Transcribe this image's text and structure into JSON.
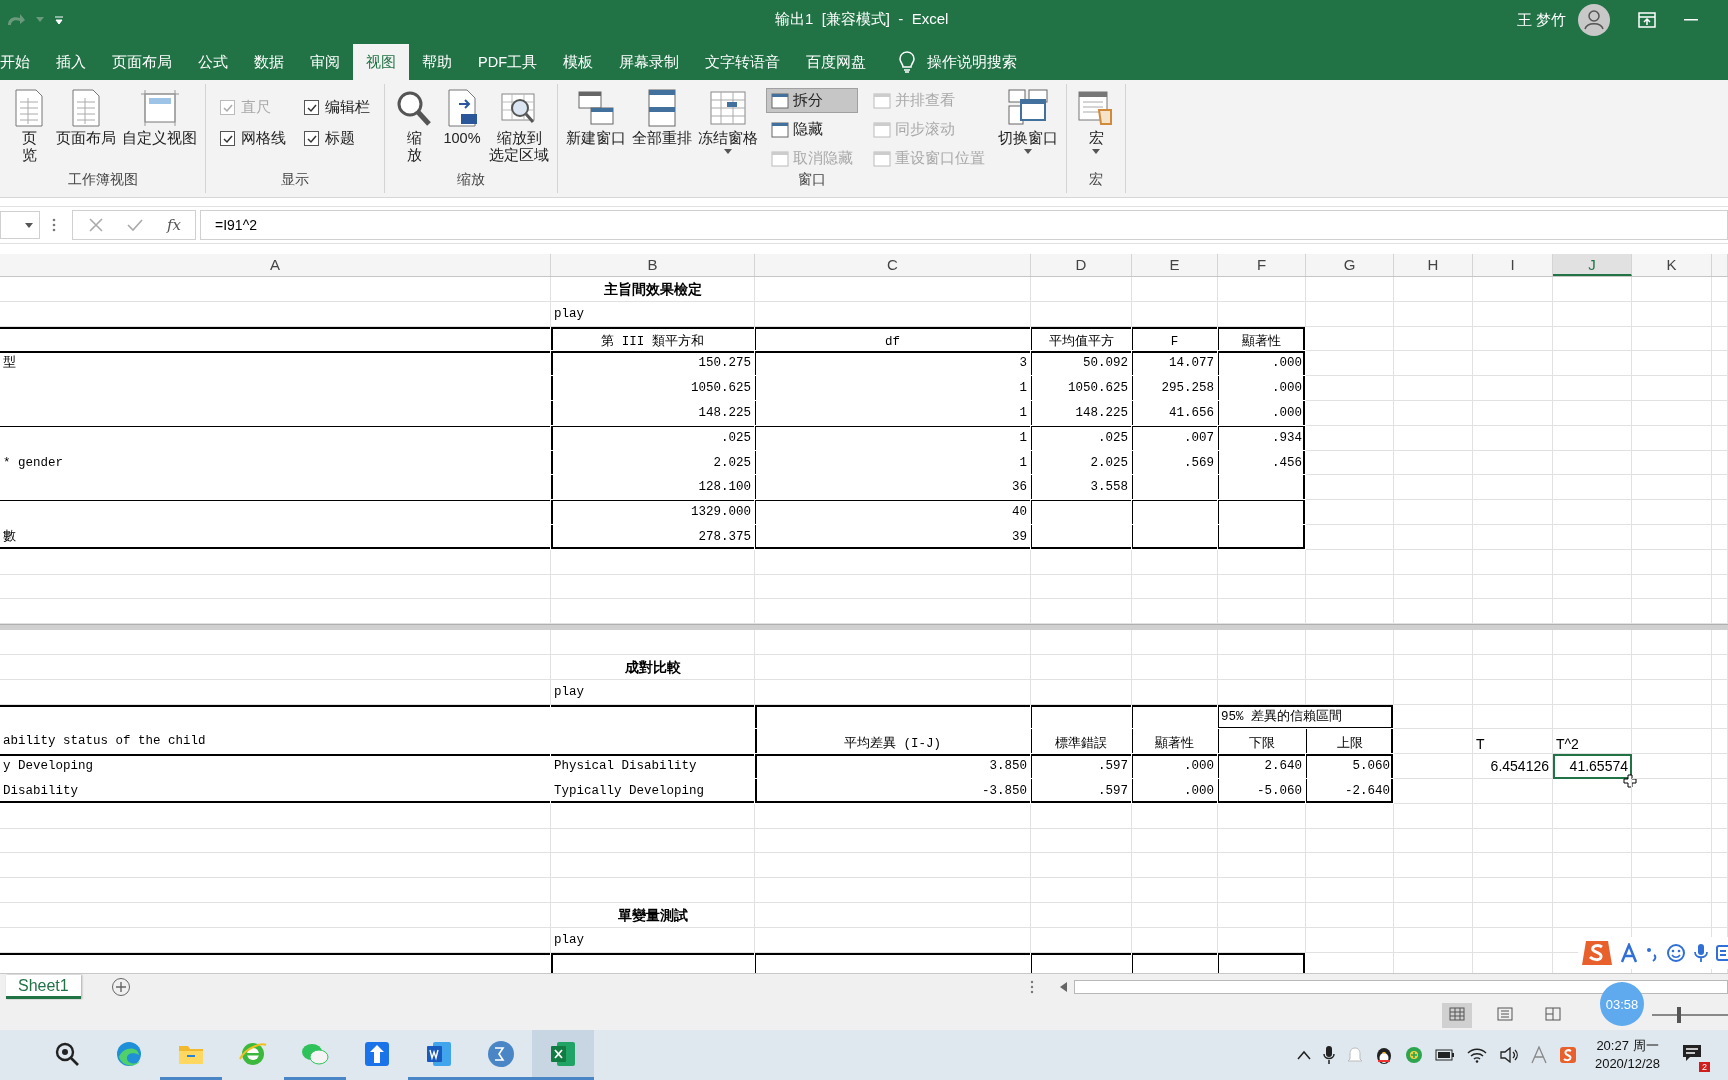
{
  "title_bar": {
    "title": "输出1  [兼容模式]  -  Excel",
    "user": "王 梦竹"
  },
  "ribbon_tabs": [
    {
      "label": "开始",
      "selected": false
    },
    {
      "label": "插入",
      "selected": false
    },
    {
      "label": "页面布局",
      "selected": false
    },
    {
      "label": "公式",
      "selected": false
    },
    {
      "label": "数据",
      "selected": false
    },
    {
      "label": "审阅",
      "selected": false
    },
    {
      "label": "视图",
      "selected": true
    },
    {
      "label": "帮助",
      "selected": false
    },
    {
      "label": "PDF工具",
      "selected": false
    },
    {
      "label": "模板",
      "selected": false
    },
    {
      "label": "屏幕录制",
      "selected": false
    },
    {
      "label": "文字转语音",
      "selected": false
    },
    {
      "label": "百度网盘",
      "selected": false
    }
  ],
  "tell_me": "操作说明搜索",
  "ribbon_groups": [
    {
      "label": "工作簿视图",
      "columns": [
        [
          {
            "kind": "large",
            "lines": [
              "页",
              "览"
            ]
          }
        ],
        [
          {
            "kind": "large",
            "lines": [
              "页面布局"
            ]
          }
        ],
        [
          {
            "kind": "large",
            "lines": [
              "自定义视图"
            ]
          }
        ]
      ]
    },
    {
      "label": "显示",
      "columns": [
        [
          {
            "kind": "checkbox",
            "label": "直尺",
            "checked": true,
            "disabled": true
          },
          {
            "kind": "checkbox",
            "label": "网格线",
            "checked": true,
            "disabled": false
          }
        ],
        [
          {
            "kind": "checkbox",
            "label": "编辑栏",
            "checked": true,
            "disabled": false
          },
          {
            "kind": "checkbox",
            "label": "标题",
            "checked": true,
            "disabled": false
          }
        ]
      ]
    },
    {
      "label": "缩放",
      "columns": [
        [
          {
            "kind": "large",
            "lines": [
              "缩",
              "放"
            ]
          }
        ],
        [
          {
            "kind": "large",
            "lines": [
              "100%"
            ]
          }
        ],
        [
          {
            "kind": "large",
            "lines": [
              "缩放到",
              "选定区域"
            ]
          }
        ]
      ]
    },
    {
      "label": "窗口",
      "columns": [
        [
          {
            "kind": "large",
            "lines": [
              "新建窗口"
            ]
          }
        ],
        [
          {
            "kind": "large",
            "lines": [
              "全部重排"
            ]
          }
        ],
        [
          {
            "kind": "large",
            "lines": [
              "冻结窗格"
            ],
            "dropdown": true
          }
        ],
        [
          {
            "kind": "small",
            "label": "拆分",
            "selected": true,
            "disabled": false
          },
          {
            "kind": "small",
            "label": "隐藏",
            "selected": false,
            "disabled": false
          },
          {
            "kind": "small",
            "label": "取消隐藏",
            "selected": false,
            "disabled": true
          }
        ],
        [
          {
            "kind": "small",
            "label": "并排查看",
            "selected": false,
            "disabled": true
          },
          {
            "kind": "small",
            "label": "同步滚动",
            "selected": false,
            "disabled": true
          },
          {
            "kind": "small",
            "label": "重设窗口位置",
            "selected": false,
            "disabled": true
          }
        ],
        [
          {
            "kind": "large",
            "lines": [
              "切换窗口"
            ],
            "dropdown": true
          }
        ]
      ]
    },
    {
      "label": "宏",
      "columns": [
        [
          {
            "kind": "large",
            "lines": [
              "宏"
            ],
            "dropdown": true
          }
        ]
      ]
    }
  ],
  "formula_bar": {
    "function_button": "fx",
    "formula": "=I91^2"
  },
  "sheet": {
    "columns": [
      {
        "label": "A",
        "selected": false
      },
      {
        "label": "B",
        "selected": false
      },
      {
        "label": "C",
        "selected": false
      },
      {
        "label": "D",
        "selected": false
      },
      {
        "label": "E",
        "selected": false
      },
      {
        "label": "F",
        "selected": false
      },
      {
        "label": "G",
        "selected": false
      },
      {
        "label": "H",
        "selected": false
      },
      {
        "label": "I",
        "selected": false
      },
      {
        "label": "J",
        "selected": true
      },
      {
        "label": "K",
        "selected": false
      }
    ],
    "rows": [
      {
        "kind": "plain",
        "cells": {
          "B": {
            "text": "主旨間效果檢定",
            "kind": "title"
          }
        }
      },
      {
        "kind": "plain",
        "cells": {
          "B": {
            "text": "play",
            "kind": "text"
          }
        }
      },
      {
        "kind": "thead-top",
        "cells": {
          "B": {
            "text": "第 III 類平方和",
            "kind": "head"
          },
          "C": {
            "text": "df",
            "kind": "head"
          },
          "D": {
            "text": "平均值平方",
            "kind": "head"
          },
          "E": {
            "text": "F",
            "kind": "head"
          },
          "F": {
            "text": "顯著性",
            "kind": "head"
          }
        }
      },
      {
        "kind": "body-first",
        "cells": {
          "A": {
            "text": "型",
            "kind": "text"
          },
          "B": {
            "text": "150.275",
            "kind": "num"
          },
          "C": {
            "text": "3",
            "kind": "num"
          },
          "D": {
            "text": "50.092",
            "kind": "num"
          },
          "E": {
            "text": "14.077",
            "kind": "num"
          },
          "F": {
            "text": ".000",
            "kind": "num"
          }
        }
      },
      {
        "kind": "body",
        "cells": {
          "B": {
            "text": "1050.625",
            "kind": "num"
          },
          "C": {
            "text": "1",
            "kind": "num"
          },
          "D": {
            "text": "1050.625",
            "kind": "num"
          },
          "E": {
            "text": "295.258",
            "kind": "num"
          },
          "F": {
            "text": ".000",
            "kind": "num"
          }
        }
      },
      {
        "kind": "body",
        "cells": {
          "B": {
            "text": "148.225",
            "kind": "num"
          },
          "C": {
            "text": "1",
            "kind": "num"
          },
          "D": {
            "text": "148.225",
            "kind": "num"
          },
          "E": {
            "text": "41.656",
            "kind": "num"
          },
          "F": {
            "text": ".000",
            "kind": "num"
          }
        }
      },
      {
        "kind": "body-rule",
        "cells": {
          "B": {
            "text": ".025",
            "kind": "num"
          },
          "C": {
            "text": "1",
            "kind": "num"
          },
          "D": {
            "text": ".025",
            "kind": "num"
          },
          "E": {
            "text": ".007",
            "kind": "num"
          },
          "F": {
            "text": ".934",
            "kind": "num"
          }
        }
      },
      {
        "kind": "body",
        "cells": {
          "A": {
            "text": "* gender",
            "kind": "text"
          },
          "B": {
            "text": "2.025",
            "kind": "num"
          },
          "C": {
            "text": "1",
            "kind": "num"
          },
          "D": {
            "text": "2.025",
            "kind": "num"
          },
          "E": {
            "text": ".569",
            "kind": "num"
          },
          "F": {
            "text": ".456",
            "kind": "num"
          }
        }
      },
      {
        "kind": "body",
        "cells": {
          "B": {
            "text": "128.100",
            "kind": "num"
          },
          "C": {
            "text": "36",
            "kind": "num"
          },
          "D": {
            "text": "3.558",
            "kind": "num"
          }
        }
      },
      {
        "kind": "body-rule",
        "cells": {
          "B": {
            "text": "1329.000",
            "kind": "num"
          },
          "C": {
            "text": "40",
            "kind": "num"
          }
        }
      },
      {
        "kind": "body-last",
        "cells": {
          "A": {
            "text": "數",
            "kind": "text"
          },
          "B": {
            "text": "278.375",
            "kind": "num"
          },
          "C": {
            "text": "39",
            "kind": "num"
          }
        }
      },
      {
        "kind": "plain"
      },
      {
        "kind": "plain"
      },
      {
        "kind": "plain"
      },
      {
        "kind": "split"
      },
      {
        "kind": "plain"
      },
      {
        "kind": "plain",
        "cells": {
          "B": {
            "text": "成對比較",
            "kind": "title"
          }
        }
      },
      {
        "kind": "plain",
        "cells": {
          "B": {
            "text": "play",
            "kind": "text"
          }
        }
      },
      {
        "kind": "thead-top",
        "cells": {
          "F": {
            "text": "95% 差異的信賴區間",
            "kind": "group-head"
          }
        }
      },
      {
        "kind": "thead",
        "cells": {
          "A": {
            "text": "ability status of the child",
            "kind": "text"
          },
          "C": {
            "text": "平均差異 (I-J)",
            "kind": "head"
          },
          "D": {
            "text": "標準錯誤",
            "kind": "head"
          },
          "E": {
            "text": "顯著性",
            "kind": "head"
          },
          "F": {
            "text": "下限",
            "kind": "head"
          },
          "G": {
            "text": "上限",
            "kind": "head"
          },
          "I": {
            "text": "T",
            "kind": "calc-text"
          },
          "J": {
            "text": "T^2",
            "kind": "calc-text"
          }
        }
      },
      {
        "kind": "body-first",
        "cells": {
          "A": {
            "text": "y Developing",
            "kind": "text"
          },
          "B": {
            "text": "Physical Disability",
            "kind": "text"
          },
          "C": {
            "text": "3.850",
            "kind": "num"
          },
          "D": {
            "text": ".597",
            "kind": "num"
          },
          "E": {
            "text": ".000",
            "kind": "num"
          },
          "F": {
            "text": "2.640",
            "kind": "num"
          },
          "G": {
            "text": "5.060",
            "kind": "num"
          },
          "I": {
            "text": "6.454126",
            "kind": "calc-num",
            "selected": false
          },
          "J": {
            "text": "41.65574",
            "kind": "calc-num",
            "selected": true
          }
        }
      },
      {
        "kind": "body-last",
        "cells": {
          "A": {
            "text": "Disability",
            "kind": "text"
          },
          "B": {
            "text": "Typically Developing",
            "kind": "text"
          },
          "C": {
            "text": "-3.850",
            "kind": "num"
          },
          "D": {
            "text": ".597",
            "kind": "num"
          },
          "E": {
            "text": ".000",
            "kind": "num"
          },
          "F": {
            "text": "-5.060",
            "kind": "num"
          },
          "G": {
            "text": "-2.640",
            "kind": "num"
          }
        }
      },
      {
        "kind": "plain"
      },
      {
        "kind": "plain"
      },
      {
        "kind": "plain"
      },
      {
        "kind": "plain"
      },
      {
        "kind": "plain",
        "cells": {
          "B": {
            "text": "單變量測試",
            "kind": "title"
          }
        }
      },
      {
        "kind": "plain",
        "cells": {
          "B": {
            "text": "play",
            "kind": "text"
          }
        }
      },
      {
        "kind": "thead-top"
      }
    ]
  },
  "sheet_tabs": [
    {
      "label": "Sheet1",
      "selected": true
    }
  ],
  "status_bar": {
    "views": [
      {
        "selected": true
      },
      {
        "selected": false
      },
      {
        "selected": false
      }
    ],
    "zoom": {
      "level": 0.35
    }
  },
  "ime_bar": {
    "timer": "03:58"
  },
  "taskbar": {
    "apps": [
      {
        "running": false,
        "selected": false
      },
      {
        "running": false,
        "selected": false
      },
      {
        "running": true,
        "selected": false
      },
      {
        "running": false,
        "selected": false
      },
      {
        "running": true,
        "selected": false
      },
      {
        "running": false,
        "selected": false
      },
      {
        "running": true,
        "selected": false
      },
      {
        "running": true,
        "selected": false
      },
      {
        "running": true,
        "selected": true
      }
    ],
    "time": "20:27 周一",
    "date": "2020/12/28",
    "notifications": "2"
  }
}
